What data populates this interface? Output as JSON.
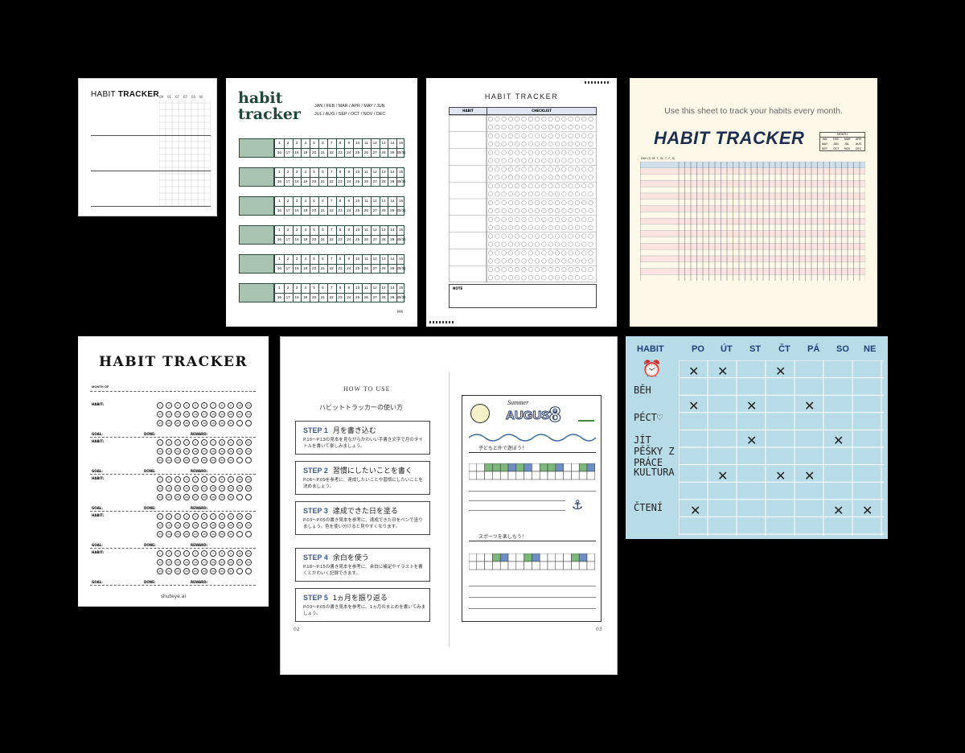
{
  "card1": {
    "title_plain": "HABIT ",
    "title_bold": "TRACKER",
    "day_headers": [
      "09",
      "01",
      "07",
      "07",
      "05",
      "W"
    ]
  },
  "card2": {
    "title": "habit tracker",
    "months_line1": "JAN / FEB / MAR / APR / MAY / JUN",
    "months_line2": "JUL / AUG / SEP / OCT / NOV / DEC",
    "row1": [
      "1",
      "2",
      "3",
      "4",
      "5",
      "6",
      "7",
      "8",
      "9",
      "10",
      "11",
      "12",
      "13",
      "14",
      "15"
    ],
    "row2": [
      "16",
      "17",
      "18",
      "19",
      "20",
      "21",
      "22",
      "23",
      "24",
      "25",
      "26",
      "27",
      "28",
      "29",
      "30/31"
    ],
    "footer": "MM"
  },
  "card3": {
    "title": "HABIT TRACKER",
    "col_habit": "HABIT",
    "col_checklist": "CHECKLIST",
    "note": "NOTE"
  },
  "card4": {
    "subtitle": "Use this sheet to track your habits every month.",
    "title": "HABIT TRACKER",
    "month_label": "MONTH",
    "months": [
      "JAN",
      "FEB",
      "MAR",
      "APR",
      "MAY",
      "JUN",
      "JUL",
      "AUG",
      "SEP",
      "OCT",
      "NOV",
      "DEC"
    ],
    "day_label": "DAY (S, M, T, W, T, F, S)"
  },
  "card5": {
    "title": "HABIT TRACKER",
    "month_of": "MONTH OF",
    "habit": "HABIT:",
    "goal": "GOAL:",
    "done": "DONE:",
    "reward": "REWARD:",
    "footer": "shuteye.ai"
  },
  "card6": {
    "how_to_use": "HOW TO USE",
    "how_jp": "ハビットトラッカーの使い方",
    "steps": [
      {
        "label": "STEP 1",
        "title": "月を書き込む",
        "text": "P.10～P.13の見本を見ながらかわいい手書き文字で月のタイトルを書いて楽しみましょう。"
      },
      {
        "label": "STEP 2",
        "title": "習慣にしたいことを書く",
        "text": "P.06～P.09を参考に、達成したいことや習慣にしたいことを決めましょう。"
      },
      {
        "label": "STEP 3",
        "title": "達成できた日を塗る",
        "text": "P.03～P.05の書き見本を参考に、達成できた日をペンで塗りましょう。色を使い分けると見やすくなります。"
      },
      {
        "label": "STEP 4",
        "title": "余白を使う",
        "text": "P.18～P.15の書き見本を参考に、余白に補足やイラストを書くとかわいく記録できます。"
      },
      {
        "label": "STEP 5",
        "title": "1ヵ月を振り返る",
        "text": "P.03～P.05の書き見本を参考に、1ヵ月のまとめを書いてみましょう。"
      }
    ],
    "page_title_small": "Summer",
    "page_title": "AUGUST",
    "page_number_big": "8",
    "goal1": "子どもと外で遊ぼう！",
    "goal2": "スポーツを楽しもう！",
    "page_left": "02",
    "page_right": "03"
  },
  "card7": {
    "headers": [
      "HABIT",
      "PO",
      "ÚT",
      "ST",
      "ČT",
      "PÁ",
      "SO",
      "NE"
    ],
    "habits": [
      "BĚH",
      "PÉCT♡",
      "JÍT PĚŠKY Z PRÁCE",
      "KULTURA",
      "ČTENÍ"
    ],
    "mark": "✕",
    "colors": {
      "bg": "#b8dbe8",
      "header": "#1d3f7a"
    }
  }
}
